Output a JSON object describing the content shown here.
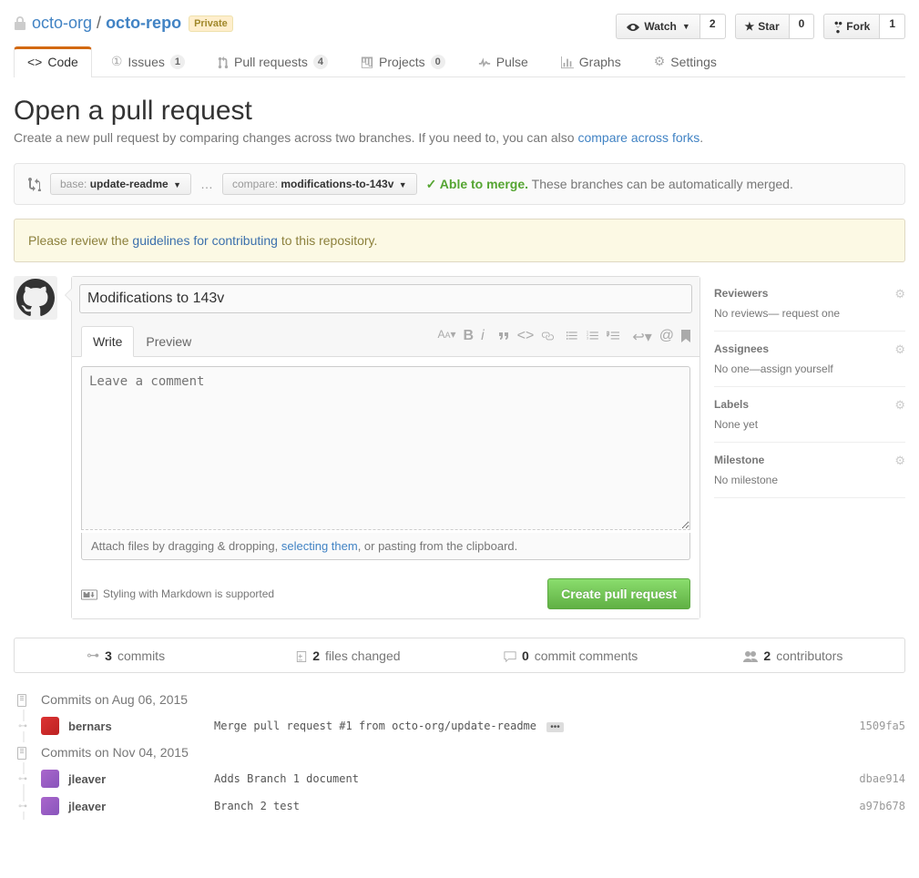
{
  "repo": {
    "org": "octo-org",
    "name": "octo-repo",
    "privacy": "Private"
  },
  "actions": {
    "watch": {
      "label": "Watch",
      "count": "2"
    },
    "star": {
      "label": "Star",
      "count": "0"
    },
    "fork": {
      "label": "Fork",
      "count": "1"
    }
  },
  "nav": {
    "code": "Code",
    "issues": {
      "label": "Issues",
      "count": "1"
    },
    "pulls": {
      "label": "Pull requests",
      "count": "4"
    },
    "projects": {
      "label": "Projects",
      "count": "0"
    },
    "pulse": "Pulse",
    "graphs": "Graphs",
    "settings": "Settings"
  },
  "page": {
    "title": "Open a pull request",
    "subtitle_pre": "Create a new pull request by comparing changes across two branches. If you need to, you can also ",
    "subtitle_link": "compare across forks",
    "subtitle_post": "."
  },
  "range": {
    "base_label": "base:",
    "base_val": "update-readme",
    "compare_label": "compare:",
    "compare_val": "modifications-to-143v",
    "ok": "Able to merge.",
    "msg": "These branches can be automatically merged."
  },
  "flash": {
    "pre": "Please review the ",
    "link": "guidelines for contributing",
    "post": " to this repository."
  },
  "form": {
    "title_value": "Modifications to 143v",
    "tab_write": "Write",
    "tab_preview": "Preview",
    "placeholder": "Leave a comment",
    "drag_pre": "Attach files by dragging & dropping, ",
    "drag_link": "selecting them",
    "drag_post": ", or pasting from the clipboard.",
    "md_hint": "Styling with Markdown is supported",
    "submit": "Create pull request"
  },
  "sidebar": {
    "reviewers": {
      "title": "Reviewers",
      "text": "No reviews— request one"
    },
    "assignees": {
      "title": "Assignees",
      "text": "No one—assign yourself"
    },
    "labels": {
      "title": "Labels",
      "text": "None yet"
    },
    "milestone": {
      "title": "Milestone",
      "text": "No milestone"
    }
  },
  "stats": {
    "commits": {
      "n": "3",
      "label": " commits"
    },
    "files": {
      "n": "2",
      "label": " files changed"
    },
    "comments": {
      "n": "0",
      "label": " commit comments"
    },
    "contribs": {
      "n": "2",
      "label": " contributors"
    }
  },
  "commit_groups": [
    {
      "title": "Commits on Aug 06, 2015",
      "commits": [
        {
          "author": "bernars",
          "avatar": "b",
          "msg": "Merge pull request #1 from octo-org/update-readme",
          "ellipsis": true,
          "sha": "1509fa5"
        }
      ]
    },
    {
      "title": "Commits on Nov 04, 2015",
      "commits": [
        {
          "author": "jleaver",
          "avatar": "j",
          "msg": "Adds Branch 1 document",
          "sha": "dbae914"
        },
        {
          "author": "jleaver",
          "avatar": "j",
          "msg": "Branch 2 test",
          "sha": "a97b678"
        }
      ]
    }
  ]
}
